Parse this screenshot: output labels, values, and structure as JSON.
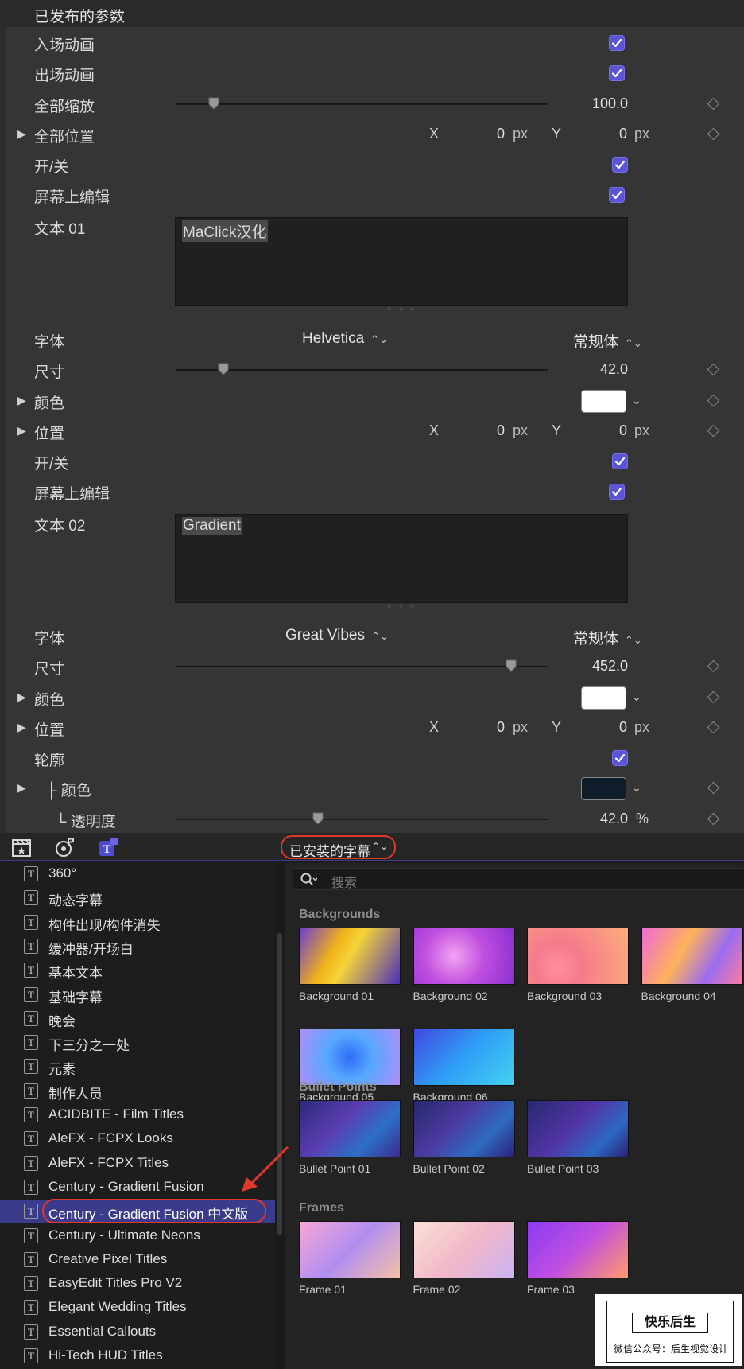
{
  "inspector": {
    "header": "已发布的参数",
    "rows": {
      "in_anim": "入场动画",
      "out_anim": "出场动画",
      "all_scale": "全部缩放",
      "all_scale_val": "100.0",
      "all_pos": "全部位置",
      "onoff1": "开/关",
      "edit1": "屏幕上编辑",
      "text01_label": "文本 01",
      "text01_value": "MaClick汉化",
      "font1_label": "字体",
      "font1_value": "Helvetica",
      "font1_style": "常规体",
      "size1_label": "尺寸",
      "size1_val": "42.0",
      "color1_label": "颜色",
      "pos1_label": "位置",
      "onoff2": "开/关",
      "edit2": "屏幕上编辑",
      "text02_label": "文本 02",
      "text02_value": "Gradient",
      "font2_label": "字体",
      "font2_value": "Great Vibes",
      "font2_style": "常规体",
      "size2_label": "尺寸",
      "size2_val": "452.0",
      "color2_label": "颜色",
      "pos2_label": "位置",
      "outline_label": "轮廓",
      "outline_color_label": "├ 颜色",
      "opacity_label": "└ 透明度",
      "opacity_val": "42.0",
      "opacity_unit": "%"
    },
    "xy": {
      "x_label": "X",
      "y_label": "Y",
      "x_value": "0",
      "y_value": "0",
      "unit": "px"
    },
    "slider_levels": {
      "all_scale": 0.1,
      "size1": 0.125,
      "size2": 0.9,
      "opacity": 0.38
    },
    "colors": {
      "accent": "#5b55d6",
      "swatch_white": "#ffffff",
      "swatch_outline": "#0f1d2b"
    }
  },
  "browser": {
    "toolbar": {
      "icons": [
        "clapper-star-icon",
        "music-photo-icon",
        "titles-icon"
      ],
      "popup_label": "已安装的字幕"
    },
    "sidebar_items": [
      "360°",
      "动态字幕",
      "构件出现/构件消失",
      "缓冲器/开场白",
      "基本文本",
      "基础字幕",
      "晚会",
      "下三分之一处",
      "元素",
      "制作人员",
      "ACIDBITE - Film Titles",
      "AleFX - FCPX Looks",
      "AleFX - FCPX Titles",
      "Century - Gradient Fusion",
      "Century - Gradient Fusion 中文版",
      "Century - Ultimate Neons",
      "Creative Pixel Titles",
      "EasyEdit Titles Pro V2",
      "Elegant Wedding Titles",
      "Essential Callouts",
      "Hi-Tech HUD Titles"
    ],
    "selected_index": 14,
    "search_placeholder": "搜索",
    "sections": [
      {
        "title": "Backgrounds",
        "items": [
          "Background 01",
          "Background 02",
          "Background 03",
          "Background 04",
          "Background 05",
          "Background 06"
        ]
      },
      {
        "title": "Bullet Points",
        "items": [
          "Bullet Point 01",
          "Bullet Point 02",
          "Bullet Point 03"
        ]
      },
      {
        "title": "Frames",
        "items": [
          "Frame 01",
          "Frame 02",
          "Frame 03"
        ]
      }
    ],
    "highlight_color": "#e0392b"
  },
  "watermark": {
    "line1": "快乐后生",
    "line2": "微信公众号：后生视觉设计"
  }
}
